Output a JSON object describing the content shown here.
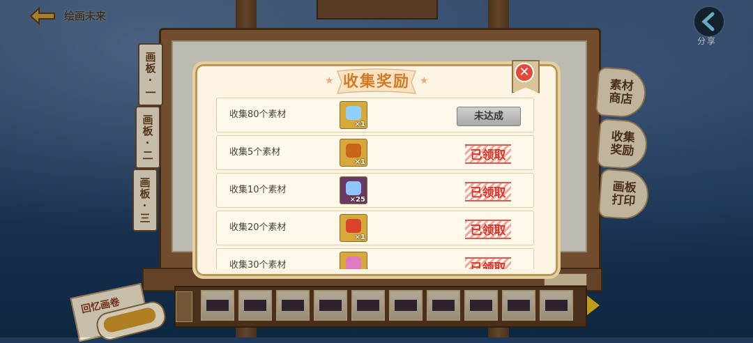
{
  "header": {
    "back_label": "绘画未来",
    "share_label": "分享"
  },
  "board_tabs": [
    "画板·一",
    "画板·二",
    "画板·三"
  ],
  "side_tags": [
    {
      "line1": "素材",
      "line2": "商店"
    },
    {
      "line1": "收集",
      "line2": "奖励"
    },
    {
      "line1": "画板",
      "line2": "打印"
    }
  ],
  "bottom": {
    "memory_label": "回忆画卷"
  },
  "dialog": {
    "title": "收集奖励",
    "close_symbol": "✕",
    "rows": [
      {
        "label": "收集80个素材",
        "qty": "×1",
        "icon": "sparkle-gift-icon",
        "status": "未达成",
        "claimed": false,
        "icon_bg": "#d6a93a",
        "icon_color": "#8fd0ff"
      },
      {
        "label": "收集5个素材",
        "qty": "×1",
        "icon": "treasure-chest-icon",
        "status": "已领取",
        "claimed": true,
        "icon_bg": "#d6a93a",
        "icon_color": "#c8641c"
      },
      {
        "label": "收集10个素材",
        "qty": "×25",
        "icon": "crystal-shard-icon",
        "status": "已领取",
        "claimed": true,
        "icon_bg": "#6a3b62",
        "icon_color": "#8fc4ff"
      },
      {
        "label": "收集20个素材",
        "qty": "×1",
        "icon": "mystery-book-icon",
        "status": "已领取",
        "claimed": true,
        "icon_bg": "#d6a93a",
        "icon_color": "#d8432a"
      },
      {
        "label": "收集30个素材",
        "qty": "",
        "icon": "lotus-gem-icon",
        "status": "已领取",
        "claimed": true,
        "icon_bg": "#d6a93a",
        "icon_color": "#e07ac0"
      }
    ]
  },
  "colors": {
    "accent": "#d27a24",
    "stamp_red": "#d8362c",
    "close_red": "#e24a3a"
  }
}
